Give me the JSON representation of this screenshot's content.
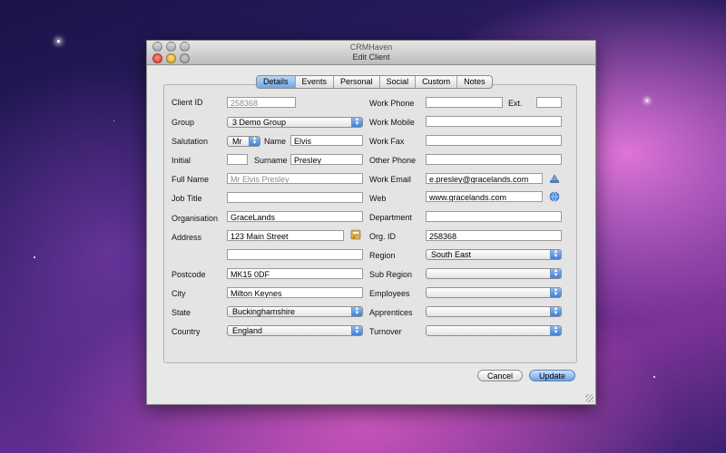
{
  "window": {
    "app_title": "CRMHaven",
    "dialog_title": "Edit Client"
  },
  "tabs": [
    {
      "label": "Details",
      "active": true
    },
    {
      "label": "Events",
      "active": false
    },
    {
      "label": "Personal",
      "active": false
    },
    {
      "label": "Social",
      "active": false
    },
    {
      "label": "Custom",
      "active": false
    },
    {
      "label": "Notes",
      "active": false
    }
  ],
  "left": {
    "client_id": {
      "label": "Client ID",
      "value": "258368"
    },
    "group": {
      "label": "Group",
      "value": "3 Demo Group"
    },
    "salutation": {
      "label": "Salutation",
      "value": "Mr"
    },
    "name": {
      "label": "Name",
      "value": "Elvis"
    },
    "initial": {
      "label": "Initial",
      "value": ""
    },
    "surname": {
      "label": "Surname",
      "value": "Presley"
    },
    "full_name": {
      "label": "Full Name",
      "value": "Mr Elvis Presley"
    },
    "job_title": {
      "label": "Job Title",
      "value": ""
    },
    "organisation": {
      "label": "Organisation",
      "value": "GraceLands"
    },
    "address": {
      "label": "Address",
      "value": "123 Main Street",
      "value2": ""
    },
    "postcode": {
      "label": "Postcode",
      "value": "MK15 0DF"
    },
    "city": {
      "label": "City",
      "value": "Milton Keynes"
    },
    "state": {
      "label": "State",
      "value": "Buckinghamshire"
    },
    "country": {
      "label": "Country",
      "value": "England"
    }
  },
  "right": {
    "work_phone": {
      "label": "Work Phone",
      "value": ""
    },
    "ext": {
      "label": "Ext.",
      "value": ""
    },
    "work_mobile": {
      "label": "Work Mobile",
      "value": ""
    },
    "work_fax": {
      "label": "Work Fax",
      "value": ""
    },
    "other_phone": {
      "label": "Other Phone",
      "value": ""
    },
    "work_email": {
      "label": "Work Email",
      "value": "e.presley@gracelands.com"
    },
    "web": {
      "label": "Web",
      "value": "www.gracelands.com"
    },
    "department": {
      "label": "Department",
      "value": ""
    },
    "org_id": {
      "label": "Org. ID",
      "value": "258368"
    },
    "region": {
      "label": "Region",
      "value": "South East"
    },
    "sub_region": {
      "label": "Sub Region",
      "value": ""
    },
    "employees": {
      "label": "Employees",
      "value": ""
    },
    "apprentices": {
      "label": "Apprentices",
      "value": ""
    },
    "turnover": {
      "label": "Turnover",
      "value": ""
    }
  },
  "buttons": {
    "cancel": "Cancel",
    "update": "Update"
  },
  "icons": {
    "address_book": "address-book-icon",
    "mail": "mail-icon",
    "web": "globe-icon"
  },
  "colors": {
    "accent": "#5a9ae6",
    "tab_active": "#6ea6e8"
  }
}
